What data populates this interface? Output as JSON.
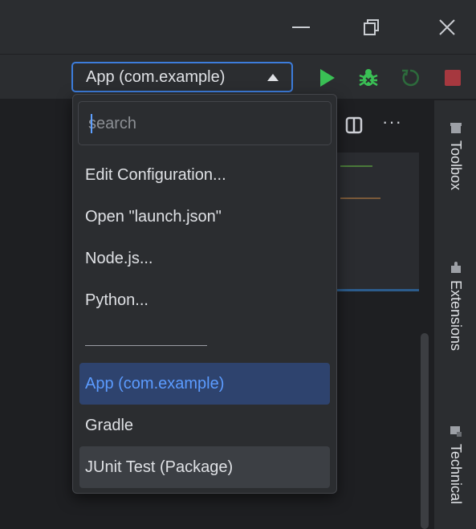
{
  "titlebar": {
    "minimize_icon": "minimize-icon",
    "maximize_icon": "restore-icon",
    "close_icon": "close-icon"
  },
  "toolbar": {
    "run_configuration": "App (com.example)",
    "run_icon": "run-icon",
    "debug_icon": "debug-bug-icon",
    "rerun_icon": "rerun-icon",
    "stop_icon": "stop-icon",
    "colors": {
      "run": "#3ac055",
      "debug": "#3ac055",
      "stop": "#a6383f",
      "focus_border": "#3d7ddc"
    }
  },
  "editor": {
    "split_icon": "split-editor-icon",
    "more_label": "···"
  },
  "dropdown": {
    "search_placeholder": "search",
    "search_value": "",
    "items": [
      {
        "label": "Edit Configuration..."
      },
      {
        "label": "Open \"launch.json\""
      },
      {
        "label": "Node.js..."
      },
      {
        "label": "Python..."
      },
      {
        "label": "App (com.example)",
        "state": "selected"
      },
      {
        "label": "Gradle"
      },
      {
        "label": "JUnit Test (Package)",
        "state": "hover"
      }
    ],
    "colors": {
      "selected_bg": "#2e436e",
      "selected_text": "#5b9bff",
      "hover_bg": "#3c3f44"
    }
  },
  "right_panel": {
    "tools": [
      {
        "label": "Toolbox",
        "icon": "toolbox-icon"
      },
      {
        "label": "Extensions",
        "icon": "extensions-puzzle-icon"
      },
      {
        "label": "Technical",
        "icon": "technical-icon"
      }
    ]
  }
}
